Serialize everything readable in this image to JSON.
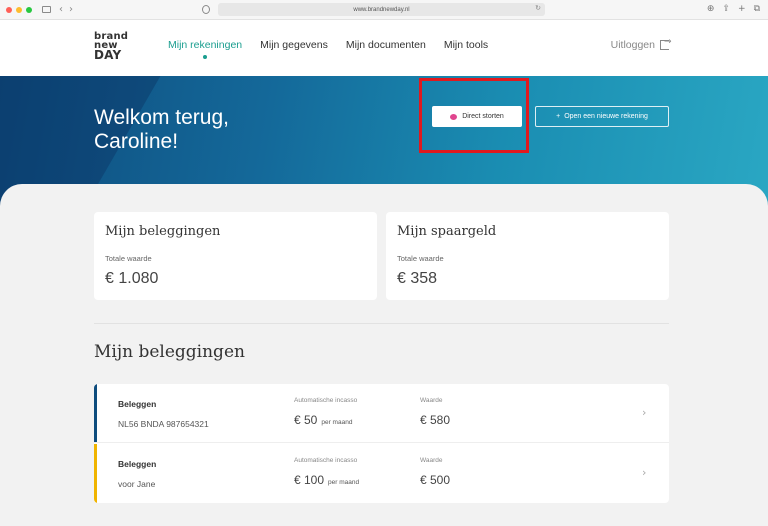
{
  "browser": {
    "url": "www.brandnewday.nl",
    "dot_colors": [
      "#ff5f57",
      "#febc2e",
      "#28c840"
    ],
    "icons": [
      "sidebar-icon",
      "back-icon",
      "forward-icon",
      "shield-icon",
      "reload-icon",
      "download-icon",
      "share-icon",
      "new-tab-icon",
      "tabs-icon"
    ]
  },
  "logo": {
    "line1": "brand",
    "line2": "new",
    "line3": "DAY"
  },
  "nav": {
    "items": [
      {
        "label": "Mijn rekeningen",
        "active": true
      },
      {
        "label": "Mijn gegevens"
      },
      {
        "label": "Mijn documenten"
      },
      {
        "label": "Mijn tools"
      }
    ],
    "logout": "Uitloggen"
  },
  "hero": {
    "title_line1": "Welkom terug,",
    "title_line2": "Caroline!",
    "deposit_button": "Direct storten",
    "open_account_button": "Open een nieuwe rekening",
    "open_account_prefix": "+"
  },
  "summary": {
    "investments": {
      "title": "Mijn beleggingen",
      "label": "Totale waarde",
      "value": "€ 1.080"
    },
    "savings": {
      "title": "Mijn spaargeld",
      "label": "Totale waarde",
      "value": "€ 358"
    }
  },
  "section": {
    "title": "Mijn beleggingen"
  },
  "accounts": [
    {
      "name": "Beleggen",
      "sub": "NL56 BNDA 987654321",
      "incasso_label": "Automatische incasso",
      "incasso": "€ 50",
      "incasso_unit": "per maand",
      "value_label": "Waarde",
      "value": "€ 580",
      "accent": "#0e4c7d"
    },
    {
      "name": "Beleggen",
      "sub": "voor Jane",
      "incasso_label": "Automatische incasso",
      "incasso": "€ 100",
      "incasso_unit": "per maand",
      "value_label": "Waarde",
      "value": "€ 500",
      "accent": "#f0b400"
    }
  ],
  "colors": {
    "brand_teal": "#1a9e8f",
    "highlight": "#e0191e",
    "piggy": "#e0458e"
  }
}
